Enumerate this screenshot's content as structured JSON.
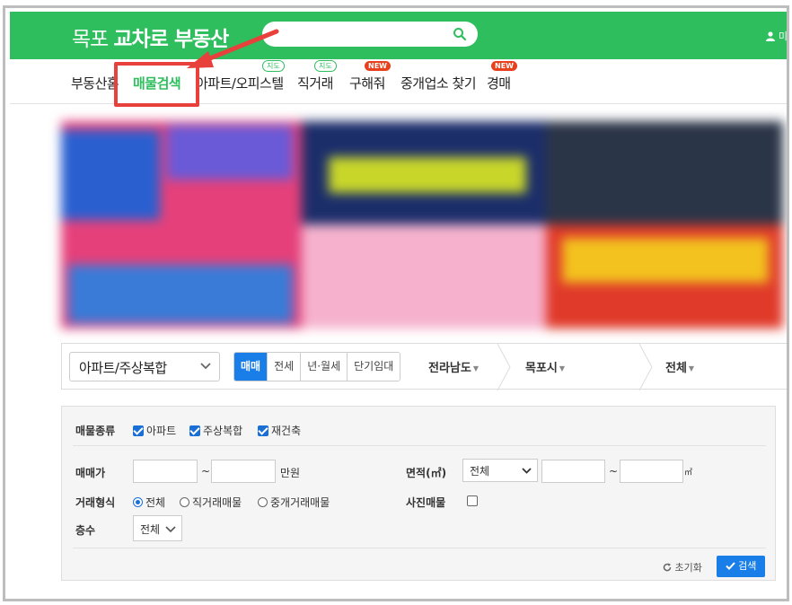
{
  "header": {
    "logo_light": "목포",
    "logo_bold": "교차로 부동산",
    "search_placeholder": "",
    "user_label": "미"
  },
  "nav": {
    "items": [
      {
        "label": "부동산홈"
      },
      {
        "label": "매물검색"
      },
      {
        "label": "아파트/오피스텔",
        "badge": "지도"
      },
      {
        "label": "직거래",
        "badge": "지도"
      },
      {
        "label": "구해줘",
        "badge": "NEW"
      },
      {
        "label": "중개업소 찾기"
      },
      {
        "label": "경매",
        "badge": "NEW"
      }
    ]
  },
  "filterbar": {
    "property_type": "아파트/주상복합",
    "deal_tabs": [
      "매매",
      "전세",
      "년·월세",
      "단기임대"
    ],
    "province": "전라남도",
    "city": "목포시",
    "district": "전체"
  },
  "panel": {
    "type_label": "매물종류",
    "types": [
      {
        "label": "아파트",
        "checked": true
      },
      {
        "label": "주상복합",
        "checked": true
      },
      {
        "label": "재건축",
        "checked": true
      }
    ],
    "price_label": "매매가",
    "price_min": "",
    "price_max": "",
    "tilde": "~",
    "price_unit": "만원",
    "area_label": "면적(㎡)",
    "area_select": "전체",
    "area_min": "",
    "area_max": "",
    "area_unit": "㎡",
    "trade_label": "거래형식",
    "trades": [
      {
        "label": "전체",
        "selected": true
      },
      {
        "label": "직거래매물",
        "selected": false
      },
      {
        "label": "중개거래매물",
        "selected": false
      }
    ],
    "photo_label": "사진매물",
    "photo_checked": false,
    "floor_label": "층수",
    "floor_select": "전체",
    "reset_label": "초기화",
    "search_label": "검색"
  },
  "colors": {
    "brand_green": "#2fbe5e",
    "accent_blue": "#1a7ee8",
    "highlight_red": "#e8403a",
    "new_badge": "#e8401c"
  }
}
